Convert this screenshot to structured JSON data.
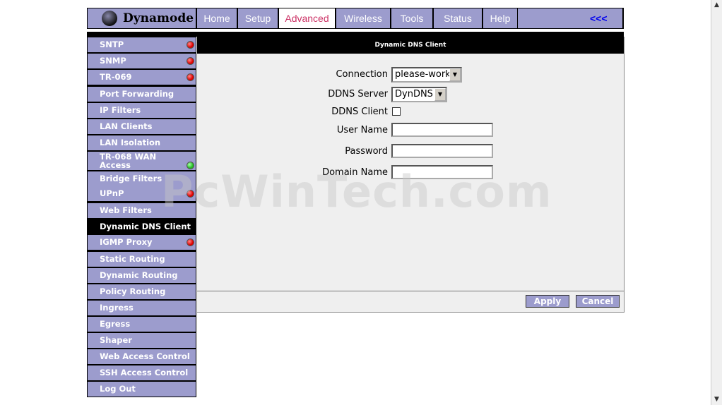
{
  "brand": {
    "name": "Dynamode"
  },
  "nav": {
    "tabs": [
      {
        "label": "Home"
      },
      {
        "label": "Setup"
      },
      {
        "label": "Advanced"
      },
      {
        "label": "Wireless"
      },
      {
        "label": "Tools"
      },
      {
        "label": "Status"
      },
      {
        "label": "Help"
      }
    ],
    "active_tab": "Advanced",
    "back_link": "<<<"
  },
  "sidebar": {
    "items": [
      {
        "label": "SNTP",
        "status": "red"
      },
      {
        "label": "SNMP",
        "status": "red"
      },
      {
        "label": "TR-069",
        "status": "red"
      },
      {
        "label": "Port Forwarding",
        "status": ""
      },
      {
        "label": "IP Filters",
        "status": ""
      },
      {
        "label": "LAN Clients",
        "status": ""
      },
      {
        "label": "LAN Isolation",
        "status": ""
      },
      {
        "label": "TR-068 WAN Access",
        "status": "green"
      },
      {
        "label": "Bridge Filters",
        "status": ""
      },
      {
        "label": "UPnP",
        "status": "red"
      },
      {
        "label": "Web Filters",
        "status": ""
      },
      {
        "label": "Dynamic DNS Client",
        "status": "",
        "active": true
      },
      {
        "label": "IGMP Proxy",
        "status": "red"
      },
      {
        "label": "Static Routing",
        "status": ""
      },
      {
        "label": "Dynamic Routing",
        "status": ""
      },
      {
        "label": "Policy Routing",
        "status": ""
      },
      {
        "label": "Ingress",
        "status": ""
      },
      {
        "label": "Egress",
        "status": ""
      },
      {
        "label": "Shaper",
        "status": ""
      },
      {
        "label": "Web Access Control",
        "status": ""
      },
      {
        "label": "SSH Access Control",
        "status": ""
      },
      {
        "label": "Log Out",
        "status": ""
      }
    ]
  },
  "main": {
    "title": "Dynamic DNS Client",
    "form": {
      "connection": {
        "label": "Connection",
        "value": "please-work"
      },
      "ddns_server": {
        "label": "DDNS Server",
        "value": "DynDNS"
      },
      "ddns_client": {
        "label": "DDNS Client",
        "checked": false
      },
      "user_name": {
        "label": "User Name",
        "value": ""
      },
      "password": {
        "label": "Password",
        "value": ""
      },
      "domain_name": {
        "label": "Domain Name",
        "value": ""
      }
    },
    "apply_label": "Apply",
    "cancel_label": "Cancel"
  },
  "watermark": "PcWinTech.com",
  "colors": {
    "nav_bg": "#9c9ccd",
    "active_tab_text": "#cc3366",
    "content_bg": "#efefef",
    "status_red": "#dd0000",
    "status_green": "#22bb22"
  }
}
